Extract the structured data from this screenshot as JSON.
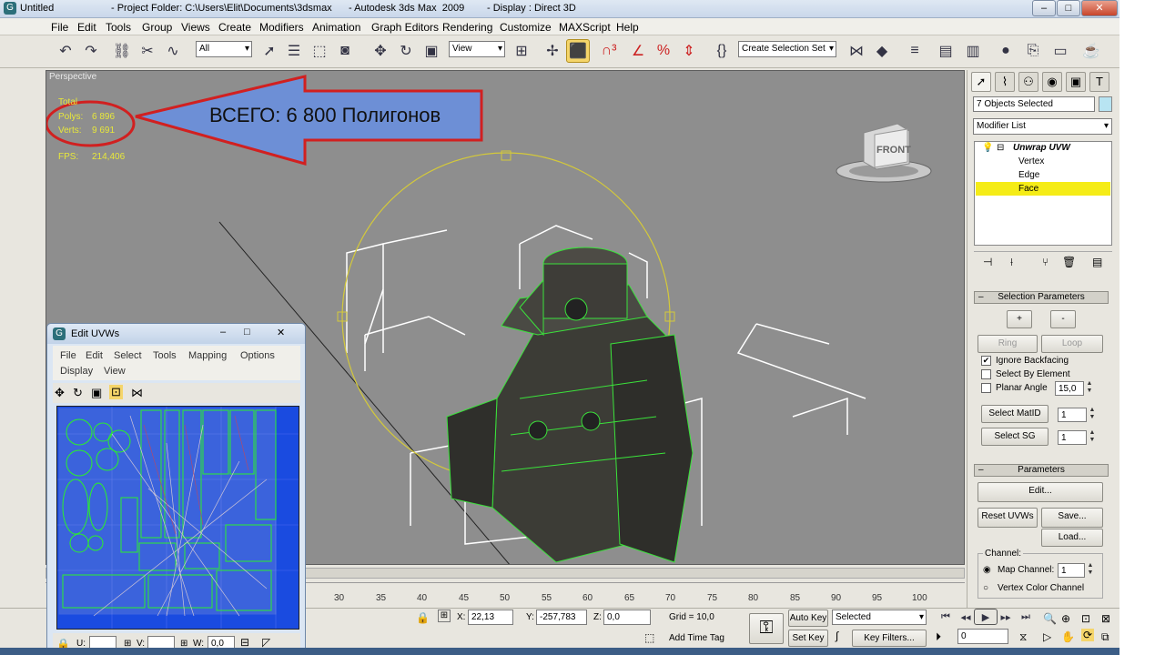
{
  "window": {
    "title_untitled": "Untitled",
    "title_project": "- Project Folder: C:\\Users\\Elit\\Documents\\3dsmax",
    "title_app": "- Autodesk 3ds Max  2009",
    "title_display": "- Display : Direct 3D"
  },
  "menu": [
    "File",
    "Edit",
    "Tools",
    "Group",
    "Views",
    "Create",
    "Modifiers",
    "Animation",
    "Graph Editors",
    "Rendering",
    "Customize",
    "MAXScript",
    "Help"
  ],
  "toolbar": {
    "selection_filter": "All",
    "ref_coord": "View",
    "named_selection": "Create Selection Set"
  },
  "viewport": {
    "label": "Perspective",
    "total_label": "Total",
    "polys_label": "Polys:",
    "polys_value": "6 896",
    "verts_label": "Verts:",
    "verts_value": "9 691",
    "fps_label": "FPS:",
    "fps_value": "214,406",
    "callout": "ВСЕГО: 6 800 Полигонов",
    "viewcube_label": "FRONT"
  },
  "command_panel": {
    "selection_count": "7 Objects Selected",
    "modifier_list": "Modifier List",
    "modifier_name": "Unwrap UVW",
    "sub_vertex": "Vertex",
    "sub_edge": "Edge",
    "sub_face": "Face",
    "selection_params_title": "Selection Parameters",
    "plus_label": "+",
    "minus_label": "-",
    "ring_label": "Ring",
    "loop_label": "Loop",
    "ignore_backfacing": "Ignore Backfacing",
    "select_by_element": "Select By Element",
    "planar_angle": "Planar Angle",
    "planar_angle_value": "15,0",
    "select_matid": "Select MatID",
    "matid_value": "1",
    "select_sg": "Select SG",
    "sg_value": "1",
    "parameters_title": "Parameters",
    "edit_label": "Edit...",
    "reset_uvws": "Reset UVWs",
    "save_label": "Save...",
    "load_label": "Load...",
    "channel_label": "Channel:",
    "map_channel": "Map Channel:",
    "map_channel_value": "1",
    "vertex_color_channel": "Vertex Color Channel"
  },
  "uv_editor": {
    "title": "Edit UVWs",
    "menu": [
      "File",
      "Edit",
      "Select",
      "Tools",
      "Mapping",
      "Options",
      "Display",
      "View"
    ],
    "u_label": "U:",
    "v_label": "V:",
    "w_label": "W:",
    "value_zero": "0,0"
  },
  "timeline": {
    "ticks": [
      "30",
      "35",
      "40",
      "45",
      "50",
      "55",
      "60",
      "65",
      "70",
      "75",
      "80",
      "85",
      "90",
      "95",
      "100"
    ]
  },
  "status": {
    "x_label": "X:",
    "x_value": "22,13",
    "y_label": "Y:",
    "y_value": "-257,783",
    "z_label": "Z:",
    "z_value": "0,0",
    "grid": "Grid = 10,0",
    "add_time_tag": "Add Time Tag",
    "auto_key": "Auto Key",
    "set_key": "Set Key",
    "key_mode": "Selected",
    "key_filters": "Key Filters...",
    "frame_value": "0"
  }
}
